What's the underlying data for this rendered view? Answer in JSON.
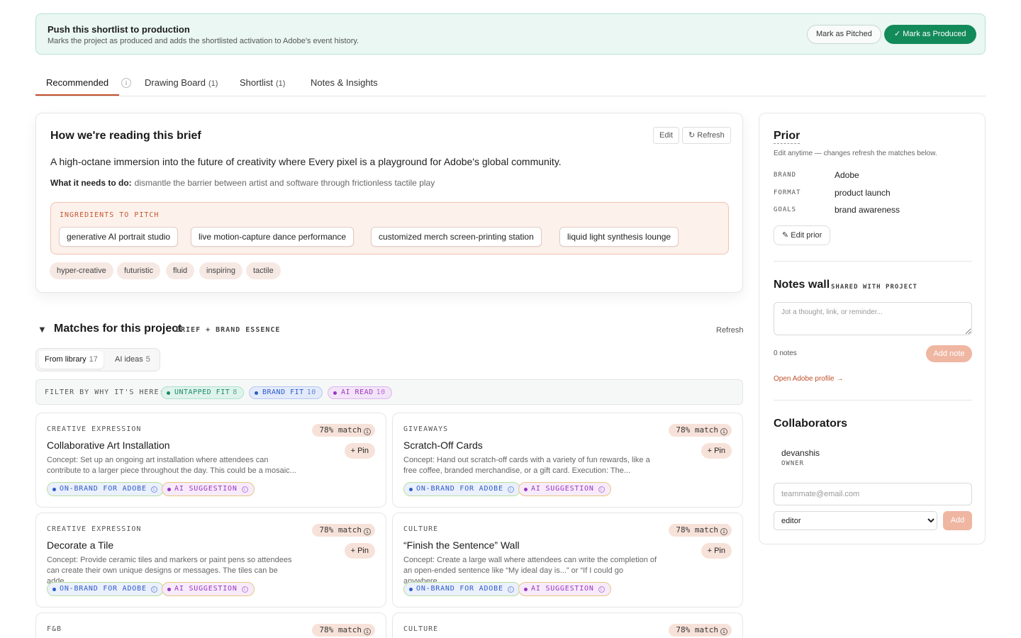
{
  "banner": {
    "title": "Push this shortlist to production",
    "subtitle": "Marks the project as produced and adds the shortlisted activation to Adobe's event history.",
    "pitched_label": "Mark as Pitched",
    "produced_label": "✓ Mark as Produced"
  },
  "tabs": [
    {
      "label": "Recommended",
      "count": "",
      "active": true
    },
    {
      "label": "Drawing Board",
      "count": "(1)"
    },
    {
      "label": "Shortlist",
      "count": "(1)"
    },
    {
      "label": "Notes & Insights",
      "count": ""
    }
  ],
  "tab_info_glyph": "i",
  "brief": {
    "title": "How we're reading this brief",
    "edit_label": "Edit",
    "refresh_label": "↻ Refresh",
    "lead": "A high-octane immersion into the future of creativity where Every pixel is a playground for Adobe's global community.",
    "need_label": "What it needs to do:",
    "need_text": "dismantle the barrier between artist and software through frictionless tactile play",
    "ingredients_label": "INGREDIENTS TO PITCH",
    "ingredients": [
      "generative AI portrait studio",
      "live motion-capture dance performance",
      "customized merch screen-printing station",
      "liquid light synthesis lounge"
    ],
    "tones": [
      "hyper-creative",
      "futuristic",
      "fluid",
      "inspiring",
      "tactile"
    ]
  },
  "matches": {
    "caret": "▼",
    "title": "Matches for this project",
    "subtitle": "BRIEF + BRAND ESSENCE",
    "refresh_label": "Refresh",
    "segments": [
      {
        "label": "From library",
        "count": "17",
        "active": true
      },
      {
        "label": "AI ideas",
        "count": "5"
      }
    ],
    "filter_label": "FILTER BY WHY IT'S HERE:",
    "filters": [
      {
        "label": "UNTAPPED FIT",
        "count": "8",
        "color": "#1a8a6a"
      },
      {
        "label": "BRAND FIT",
        "count": "10",
        "color": "#2e5bc7"
      },
      {
        "label": "AI READ",
        "count": "10",
        "color": "#9a36c0"
      }
    ],
    "cards": [
      {
        "category": "CREATIVE EXPRESSION",
        "match": "78% match",
        "title": "Collaborative Art Installation",
        "desc": "Concept: Set up an ongoing art installation where attendees can contribute to a larger piece throughout the day. This could be a mosaic..."
      },
      {
        "category": "GIVEAWAYS",
        "match": "78% match",
        "title": "Scratch-Off Cards",
        "desc": "Concept: Hand out scratch-off cards with a variety of fun rewards, like a free coffee, branded merchandise, or a gift card. Execution: The..."
      },
      {
        "category": "CREATIVE EXPRESSION",
        "match": "78% match",
        "title": "Decorate a Tile",
        "desc": "Concept: Provide ceramic tiles and markers or paint pens so attendees can create their own unique designs or messages. The tiles can be adde..."
      },
      {
        "category": "CULTURE",
        "match": "78% match",
        "title": "“Finish the Sentence” Wall",
        "desc": "Concept: Create a large wall where attendees can write the completion of an open-ended sentence like “My ideal day is...” or “If I could go anywhere..."
      },
      {
        "category": "F&B",
        "match": "78% match",
        "title": "",
        "desc": ""
      },
      {
        "category": "CULTURE",
        "match": "78% match",
        "title": "",
        "desc": ""
      }
    ],
    "pin_label": "+ Pin",
    "tag_brand": "ON-BRAND FOR ADOBE",
    "tag_ai": "AI SUGGESTION",
    "info_glyph": "i"
  },
  "prior": {
    "title": "Prior",
    "subtitle": "Edit anytime — changes refresh the matches below.",
    "fields": [
      {
        "key": "BRAND",
        "value": "Adobe"
      },
      {
        "key": "FORMAT",
        "value": "product launch"
      },
      {
        "key": "GOALS",
        "value": "brand awareness"
      }
    ],
    "edit_label": "✎ Edit prior"
  },
  "notes": {
    "title": "Notes wall",
    "subtitle": "SHARED WITH PROJECT",
    "placeholder": "Jot a thought, link, or reminder...",
    "count": "0 notes",
    "add_label": "Add note",
    "profile_link": "Open Adobe profile →"
  },
  "collaborators": {
    "title": "Collaborators",
    "members": [
      {
        "name": "devanshis",
        "role": "OWNER"
      }
    ],
    "email_placeholder": "teammate@email.com",
    "role_value": "editor",
    "add_label": "Add"
  },
  "colors": {
    "accent": "#c2502c",
    "produced": "#138a5a",
    "pin_bg": "#f7e2d9"
  }
}
